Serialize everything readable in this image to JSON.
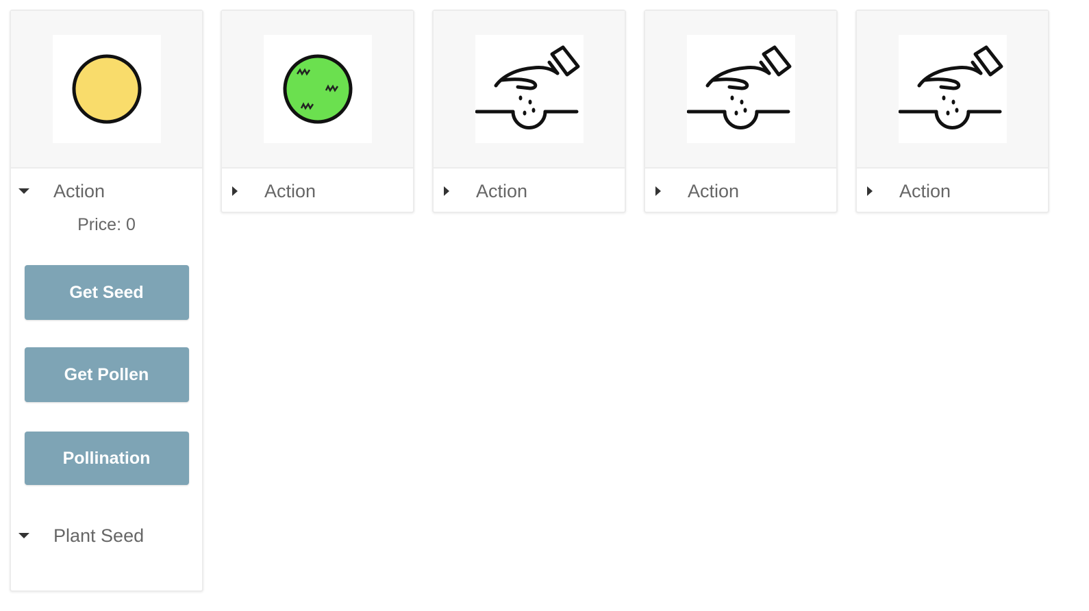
{
  "colors": {
    "button_bg": "#7ea4b5",
    "seed_fill": "#f9dc6b",
    "pollen_fill": "#6be04f"
  },
  "cards": [
    {
      "icon": "seed-icon",
      "summary_label": "Action",
      "expanded": true,
      "price_text": "Price: 0",
      "buttons": [
        "Get Seed",
        "Get Pollen",
        "Pollination"
      ],
      "sub_summary_label": "Plant Seed"
    },
    {
      "icon": "pollen-icon",
      "summary_label": "Action",
      "expanded": false
    },
    {
      "icon": "planting-hand-icon",
      "summary_label": "Action",
      "expanded": false
    },
    {
      "icon": "planting-hand-icon",
      "summary_label": "Action",
      "expanded": false
    },
    {
      "icon": "planting-hand-icon",
      "summary_label": "Action",
      "expanded": false
    }
  ]
}
